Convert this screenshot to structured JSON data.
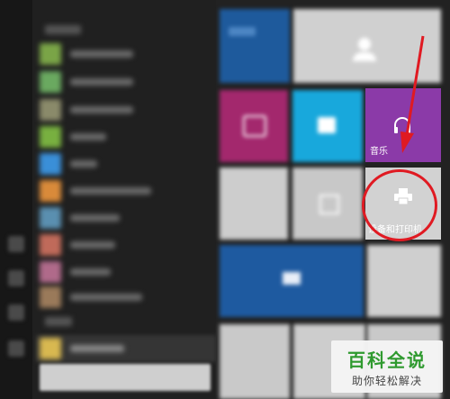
{
  "tiles": {
    "music_label": "音乐",
    "printers_label": "设备和打印机"
  },
  "watermark": {
    "title": "百科全说",
    "subtitle": "助你轻松解决"
  },
  "icons": {
    "music": "headphones-icon",
    "printers": "printer-icon",
    "user": "user-icon"
  },
  "colors": {
    "annotation_red": "#e01a22",
    "music_tile": "#8b3aa8",
    "magenta_tile": "#a3286d",
    "cyan_tile": "#18a8dc",
    "blue_tile": "#1e5aa0",
    "watermark_green": "#2f9a2f"
  }
}
